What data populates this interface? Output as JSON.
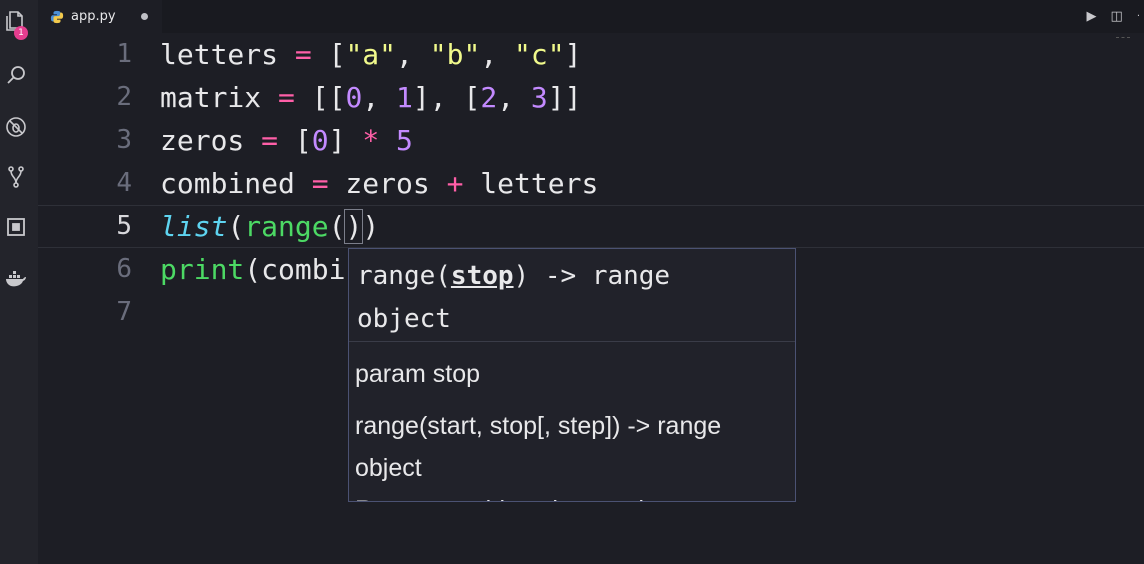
{
  "tab": {
    "filename": "app.py",
    "file_icon": "python-icon",
    "dirty": true
  },
  "tab_actions": {
    "run_icon": "play-icon",
    "split_icon": "split-editor-icon",
    "more_icon": "more-icon"
  },
  "activity_bar": {
    "items": [
      {
        "name": "explorer-icon",
        "badge": "1"
      },
      {
        "name": "search-icon"
      },
      {
        "name": "debug-icon"
      },
      {
        "name": "source-control-icon"
      },
      {
        "name": "extensions-icon"
      },
      {
        "name": "docker-icon"
      }
    ]
  },
  "editor": {
    "lines": [
      {
        "number": "1",
        "tokens": [
          {
            "t": "letters ",
            "c": ""
          },
          {
            "t": "=",
            "c": "op"
          },
          {
            "t": " [",
            "c": ""
          },
          {
            "t": "\"a\"",
            "c": "str"
          },
          {
            "t": ", ",
            "c": ""
          },
          {
            "t": "\"b\"",
            "c": "str"
          },
          {
            "t": ", ",
            "c": ""
          },
          {
            "t": "\"c\"",
            "c": "str"
          },
          {
            "t": "]",
            "c": ""
          }
        ]
      },
      {
        "number": "2",
        "tokens": [
          {
            "t": "matrix ",
            "c": ""
          },
          {
            "t": "=",
            "c": "op"
          },
          {
            "t": " [[",
            "c": ""
          },
          {
            "t": "0",
            "c": "num"
          },
          {
            "t": ", ",
            "c": ""
          },
          {
            "t": "1",
            "c": "num"
          },
          {
            "t": "], [",
            "c": ""
          },
          {
            "t": "2",
            "c": "num"
          },
          {
            "t": ", ",
            "c": ""
          },
          {
            "t": "3",
            "c": "num"
          },
          {
            "t": "]]",
            "c": ""
          }
        ]
      },
      {
        "number": "3",
        "tokens": [
          {
            "t": "zeros ",
            "c": ""
          },
          {
            "t": "=",
            "c": "op"
          },
          {
            "t": " [",
            "c": ""
          },
          {
            "t": "0",
            "c": "num"
          },
          {
            "t": "] ",
            "c": ""
          },
          {
            "t": "*",
            "c": "op"
          },
          {
            "t": " ",
            "c": ""
          },
          {
            "t": "5",
            "c": "num"
          }
        ]
      },
      {
        "number": "4",
        "tokens": [
          {
            "t": "combined ",
            "c": ""
          },
          {
            "t": "=",
            "c": "op"
          },
          {
            "t": " zeros ",
            "c": ""
          },
          {
            "t": "+",
            "c": "op"
          },
          {
            "t": " letters",
            "c": ""
          }
        ]
      },
      {
        "number": "5",
        "current": true,
        "tokens": [
          {
            "t": "list",
            "c": "builtin"
          },
          {
            "t": "(",
            "c": ""
          },
          {
            "t": "range",
            "c": "fn"
          },
          {
            "t": "(",
            "c": ""
          },
          {
            "t": ")",
            "c": "match"
          },
          {
            "t": ")",
            "c": ""
          }
        ]
      },
      {
        "number": "6",
        "tokens": [
          {
            "t": "print",
            "c": "fn"
          },
          {
            "t": "(combi",
            "c": ""
          }
        ]
      },
      {
        "number": "7",
        "tokens": []
      }
    ]
  },
  "signature_help": {
    "sig_prefix": "range(",
    "active_param": "stop",
    "sig_suffix": ") -> range",
    "sig_line2": "object",
    "doc_param": "param stop",
    "doc_alt_line1": "range(start, stop[, step]) -> range",
    "doc_alt_line2": "object",
    "doc_cutoff": "Return an object that produces"
  },
  "colors": {
    "background": "#1d1e25",
    "operator": "#ff5fa8",
    "string": "#f1fa8c",
    "number": "#c38aff",
    "function": "#4cd964",
    "builtin": "#5ed4f0",
    "badge": "#e53d8f"
  }
}
